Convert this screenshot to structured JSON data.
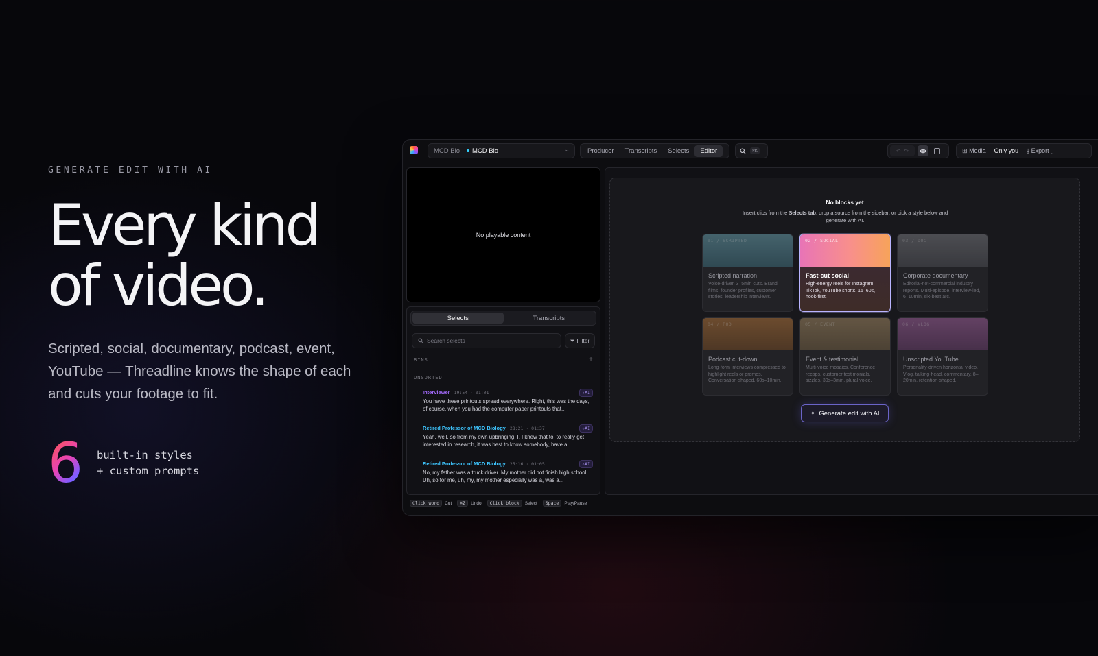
{
  "hero": {
    "eyebrow": "GENERATE EDIT WITH AI",
    "headline_line1": "Every kind",
    "headline_line2": "of video.",
    "subcopy": "Scripted, social, documentary, podcast, event, YouTube — Threadline knows the shape of each and cuts your footage to fit.",
    "stat_number": "6",
    "stat_line1": "built-in styles",
    "stat_line2": "+ custom prompts"
  },
  "topbar": {
    "project_parent": "MCD Bio",
    "project_name": "MCD Bio",
    "modes": [
      "Producer",
      "Transcripts",
      "Selects",
      "Editor"
    ],
    "active_mode": "Editor",
    "search_shortcut": "⌘K",
    "media_label": "Media",
    "visibility_label": "Only you",
    "export_label": "Export"
  },
  "viewer": {
    "empty_text": "No playable content"
  },
  "left_panel": {
    "tabs": [
      "Selects",
      "Transcripts"
    ],
    "active_tab": "Selects",
    "search_placeholder": "Search selects",
    "filter_label": "Filter",
    "bins_label": "BINS",
    "unsorted_label": "UNSORTED",
    "clips": [
      {
        "speaker": "Interviewer",
        "speaker_color": "#a56bff",
        "timecode": "19:54 · 01:01",
        "badge": "AI",
        "text": "You have these printouts spread everywhere. Right, this was the days, of course, when you had the computer paper printouts that..."
      },
      {
        "speaker": "Retired Professor of MCD Biology",
        "speaker_color": "#3ec6ff",
        "timecode": "28:21 · 01:37",
        "badge": "AI",
        "text": "Yeah, well, so from my own upbringing, I, I knew that to, to really get interested in research, it was best to know somebody, have a..."
      },
      {
        "speaker": "Retired Professor of MCD Biology",
        "speaker_color": "#3ec6ff",
        "timecode": "25:16 · 01:05",
        "badge": "AI",
        "text": "No, my father was a truck driver. My mother did not finish high school. Uh, so for me, uh, my, my mother especially was a, was a..."
      }
    ]
  },
  "editor": {
    "empty_title": "No blocks yet",
    "empty_desc_before": "Insert clips from the ",
    "empty_desc_strong": "Selects tab",
    "empty_desc_after": ", drop a source from the sidebar, or pick a style below and generate with AI.",
    "styles": [
      {
        "tag": "01 / SCRIPTED",
        "title": "Scripted narration",
        "desc": "Voice-driven 3–5min cuts. Brand films, founder profiles, customer stories, leadership interviews.",
        "selected": false,
        "gradient": "linear-gradient(180deg,#5f8d9a 0%,#3f6673 100%)"
      },
      {
        "tag": "02 / SOCIAL",
        "title": "Fast-cut social",
        "desc": "High-energy reels for Instagram, TikTok, YouTube shorts. 15–60s, hook-first.",
        "selected": true,
        "gradient": "linear-gradient(90deg,#e874b6 0%,#f88f8c 55%,#f7a35a 100%)"
      },
      {
        "tag": "03 / DOC",
        "title": "Corporate documentary",
        "desc": "Editorial-not-commercial industry reports. Multi-episode, interview-led, 6–10min, six-beat arc.",
        "selected": false,
        "gradient": "linear-gradient(180deg,#6b6c72 0%,#4c4d53 100%)"
      },
      {
        "tag": "04 / POD",
        "title": "Podcast cut-down",
        "desc": "Long-form interviews compressed to highlight reels or promos. Conversation-shaped, 60s–10min.",
        "selected": false,
        "gradient": "linear-gradient(180deg,#9c6a3c 0%,#6d4a2c 100%)"
      },
      {
        "tag": "05 / EVENT",
        "title": "Event & testimonial",
        "desc": "Multi-voice mosaics. Conference recaps, customer testimonials, sizzles. 30s–3min, plural voice.",
        "selected": false,
        "gradient": "linear-gradient(180deg,#8f7a5c 0%,#6a5a44 100%)"
      },
      {
        "tag": "06 / VLOG",
        "title": "Unscripted YouTube",
        "desc": "Personality-driven horizontal video. Vlog, talking-head, commentary. 8–20min, retention-shaped.",
        "selected": false,
        "gradient": "linear-gradient(180deg,#8e5a8c 0%,#633f66 100%)"
      }
    ],
    "generate_label": "Generate edit with AI"
  },
  "statusbar": {
    "hints": [
      {
        "key": "Click word",
        "action": "Cut"
      },
      {
        "key": "⌘Z",
        "action": "Undo"
      },
      {
        "key": "Click block",
        "action": "Select"
      },
      {
        "key": "Space",
        "action": "Play/Pause"
      }
    ]
  }
}
